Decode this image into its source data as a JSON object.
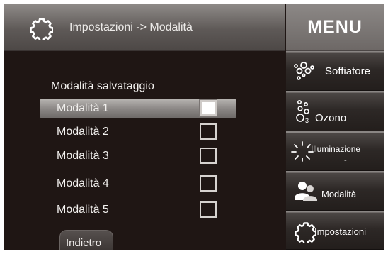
{
  "header": {
    "title": "Impostazioni -> Modalità",
    "icon": "gear-icon"
  },
  "menu": {
    "title": "MENU",
    "items": [
      {
        "label": "Soffiatore",
        "icon": "blower-icon"
      },
      {
        "label": "Ozono",
        "icon": "ozone-icon"
      },
      {
        "label": "Illuminazione",
        "icon": "light-icon",
        "suffix": "-"
      },
      {
        "label": "Modalità",
        "icon": "users-icon"
      },
      {
        "label": "Impostazioni",
        "icon": "gear-icon"
      }
    ]
  },
  "main": {
    "section_label": "Modalità salvataggio",
    "modes": [
      {
        "label": "Modalità 1",
        "selected": true
      },
      {
        "label": "Modalità 2",
        "selected": false
      },
      {
        "label": "Modalità 3",
        "selected": false
      },
      {
        "label": "Modalità 4",
        "selected": false
      },
      {
        "label": "Modalità 5",
        "selected": false
      }
    ],
    "back_label": "Indietro"
  },
  "colors": {
    "background": "#1f1614",
    "header": "#5e5957",
    "menu_panel": "#8a8684",
    "menu_button": "#2d2826",
    "selected_row": "#8c8886"
  }
}
